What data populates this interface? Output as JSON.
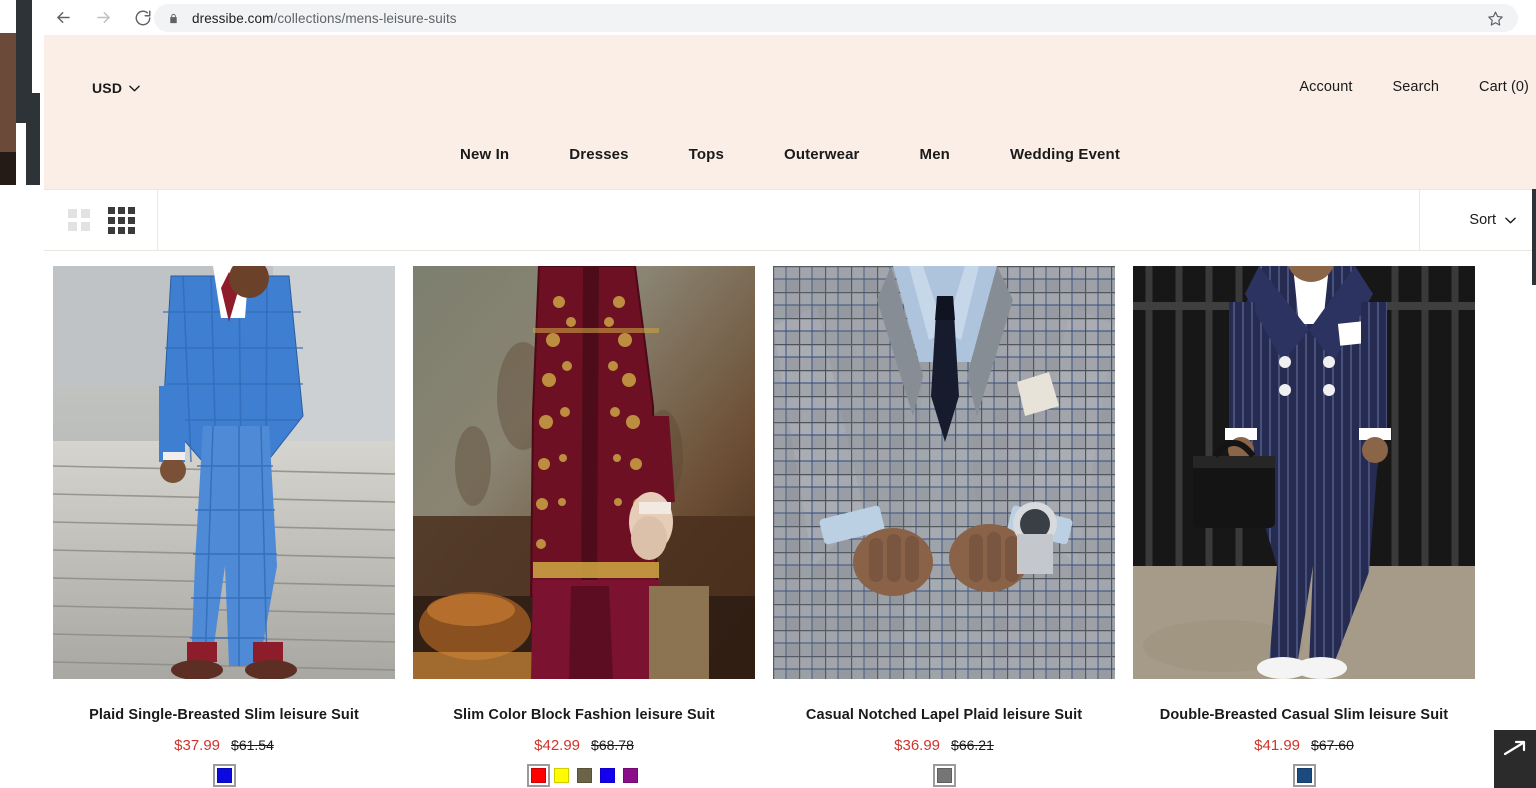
{
  "browser": {
    "back_label": "Back",
    "forward_label": "Forward",
    "reload_label": "Reload",
    "url_host": "dressibe.com",
    "url_path": "/collections/mens-leisure-suits",
    "lock_icon": "lock-icon",
    "star_icon": "bookmark-star-icon"
  },
  "header": {
    "currency": "USD",
    "currency_chevron_icon": "chevron-down-icon",
    "utility": [
      {
        "label": "Account",
        "name": "account-link"
      },
      {
        "label": "Search",
        "name": "search-link"
      },
      {
        "label": "Cart (0)",
        "name": "cart-link"
      }
    ],
    "nav": [
      "New In",
      "Dresses",
      "Tops",
      "Outerwear",
      "Men",
      "Wedding Event"
    ],
    "background_color": "#faeee6"
  },
  "toolbar": {
    "view_2col_icon": "grid-2-column-icon",
    "view_3col_icon": "grid-3-column-icon",
    "active_view": "grid-3-column-icon",
    "sort_label": "Sort",
    "sort_chevron_icon": "chevron-down-icon"
  },
  "products": [
    {
      "title": "Plaid Single-Breasted Slim leisure Suit",
      "sale_price": "$37.99",
      "compare_price": "$61.54",
      "image_alt": "man in blue plaid three-piece suit on concrete stairs",
      "swatches": [
        {
          "color": "#0a0ae0",
          "selected": true
        }
      ]
    },
    {
      "title": "Slim Color Block Fashion leisure Suit",
      "sale_price": "$42.99",
      "compare_price": "$68.78",
      "image_alt": "man in maroon gold-embroidered sherwani against rusted wall",
      "swatches": [
        {
          "color": "#fe0000",
          "selected": true
        },
        {
          "color": "#fffc00",
          "selected": false
        },
        {
          "color": "#6b6347",
          "selected": false
        },
        {
          "color": "#1300f2",
          "selected": false
        },
        {
          "color": "#8a0e8a",
          "selected": false
        }
      ]
    },
    {
      "title": "Casual Notched Lapel Plaid leisure Suit",
      "sale_price": "$36.99",
      "compare_price": "$66.21",
      "image_alt": "man in grey plaid suit with navy tie buttoning jacket",
      "swatches": [
        {
          "color": "#757575",
          "selected": true
        }
      ]
    },
    {
      "title": "Double-Breasted Casual Slim leisure Suit",
      "sale_price": "$41.99",
      "compare_price": "$67.60",
      "image_alt": "man in navy pinstripe double-breasted suit with briefcase",
      "swatches": [
        {
          "color": "#1b4a7e",
          "selected": true
        }
      ]
    }
  ],
  "floating": {
    "scroll_top_icon": "arrow-up-right-icon"
  },
  "colors": {
    "sale_price": "#d0342c",
    "header_bg": "#faeee6",
    "text": "#1a1a1a"
  }
}
